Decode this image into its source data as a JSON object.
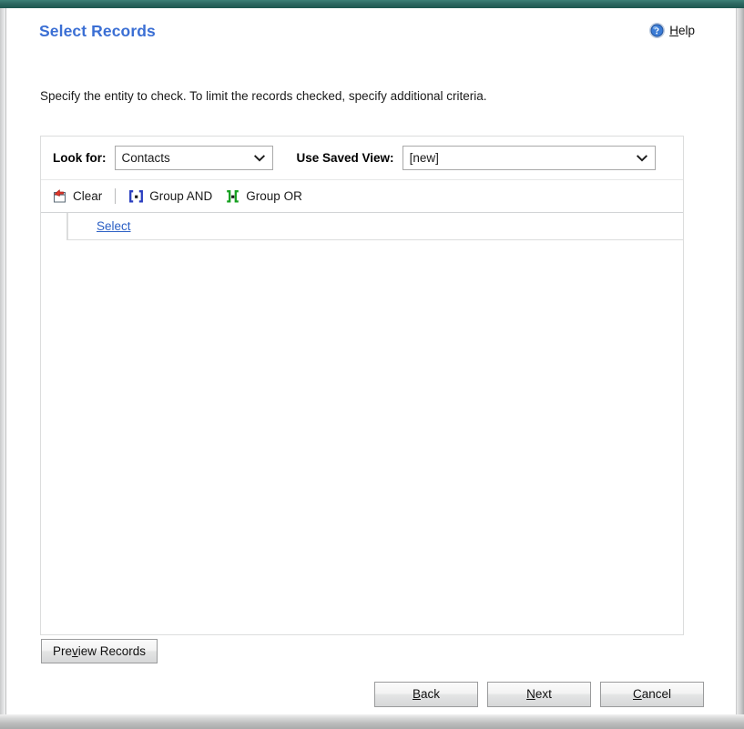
{
  "window": {
    "title": "Select Records"
  },
  "header": {
    "title": "Select Records",
    "help": {
      "icon": "help-circle-icon",
      "prefix": "",
      "accesskey": "H",
      "rest": "elp"
    }
  },
  "instruction": "Specify the entity to check. To limit the records checked, specify additional criteria.",
  "criteria": {
    "look_for": {
      "label": "Look for:",
      "value": "Contacts",
      "options": [
        "Contacts"
      ]
    },
    "saved_view": {
      "label": "Use Saved View:",
      "value": "[new]",
      "options": [
        "[new]"
      ]
    },
    "toolbar": [
      {
        "id": "clear",
        "icon": "clear-window-icon",
        "label": "Clear"
      },
      {
        "id": "group-and",
        "icon": "group-and-icon",
        "label": "Group AND"
      },
      {
        "id": "group-or",
        "icon": "group-or-icon",
        "label": "Group OR"
      }
    ],
    "rows": [
      {
        "field_link": "Select"
      }
    ]
  },
  "buttons": {
    "preview": {
      "prefix": "Pre",
      "accesskey": "v",
      "rest": "iew Records"
    },
    "back": {
      "prefix": "",
      "accesskey": "B",
      "rest": "ack"
    },
    "next": {
      "prefix": "",
      "accesskey": "N",
      "rest": "ext"
    },
    "cancel": {
      "prefix": "",
      "accesskey": "C",
      "rest": "ancel"
    }
  },
  "colors": {
    "title_blue": "#3b6fd4",
    "link_blue": "#2b5fc4",
    "top_bar_teal": "#2d6861",
    "group_and_blue": "#2b3fc0",
    "group_or_green": "#16a020",
    "clear_arrow_red": "#d7352a"
  }
}
